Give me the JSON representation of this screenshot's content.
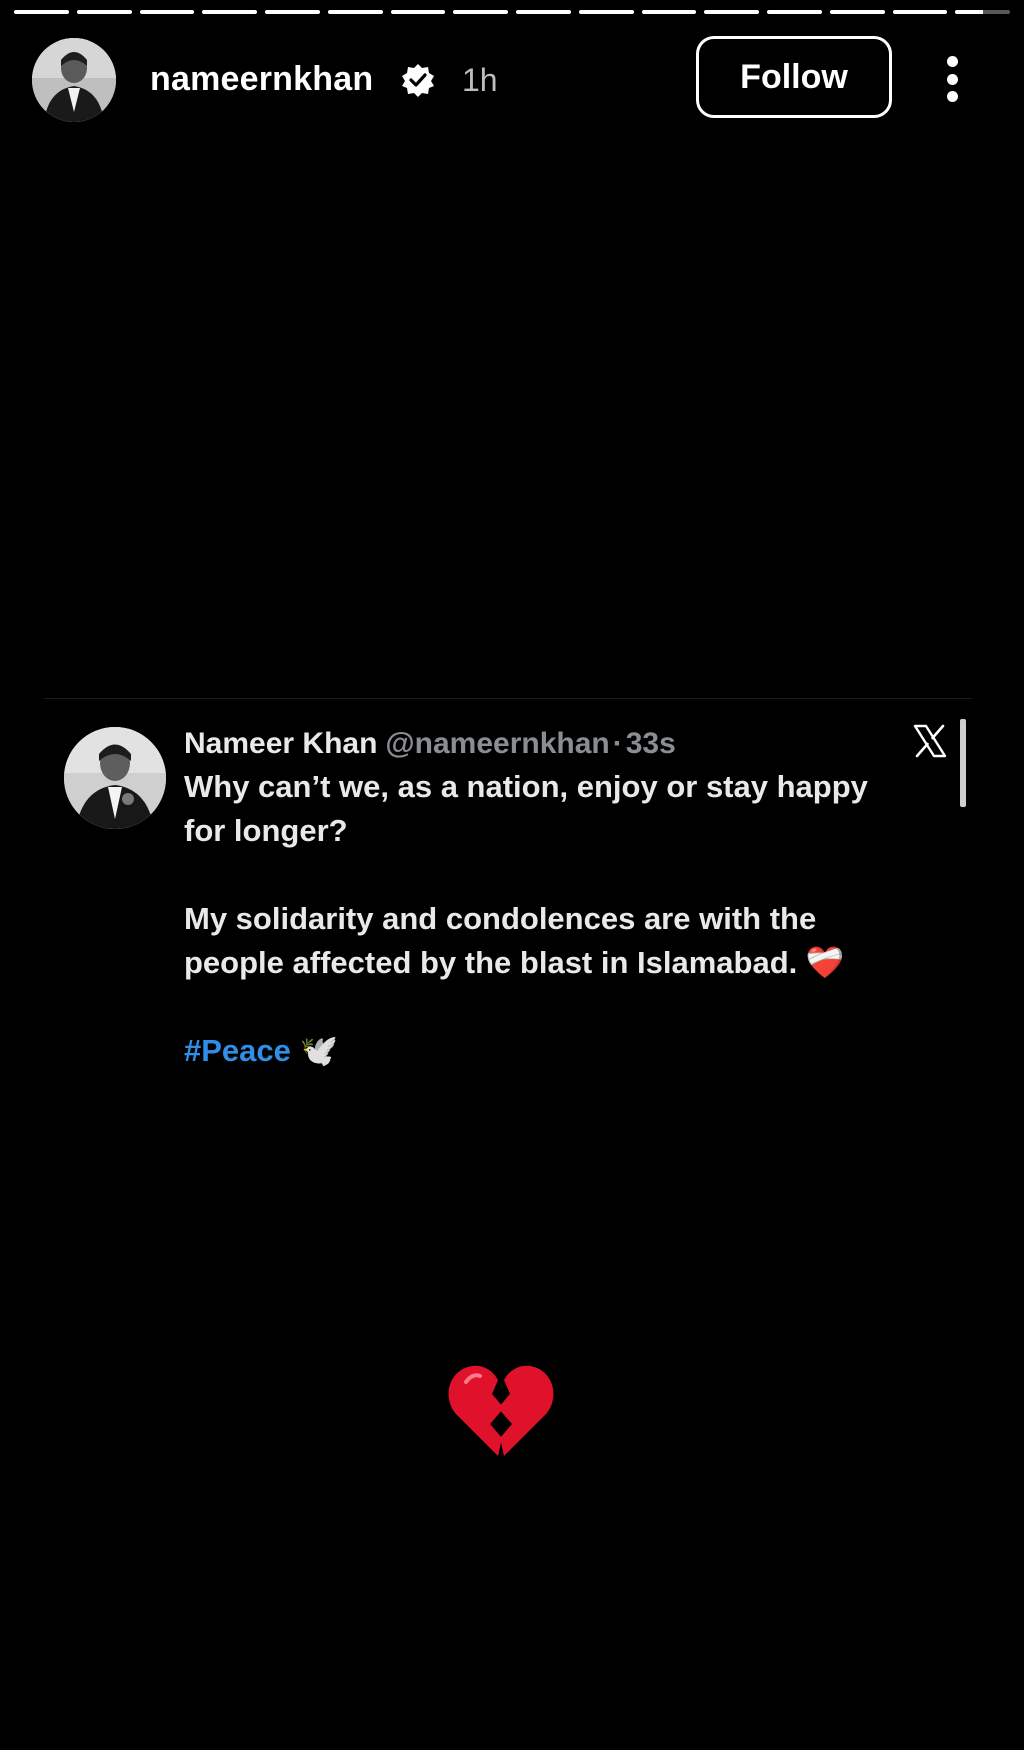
{
  "story": {
    "segments": [
      {
        "progress": 1
      },
      {
        "progress": 1
      },
      {
        "progress": 1
      },
      {
        "progress": 1
      },
      {
        "progress": 1
      },
      {
        "progress": 1
      },
      {
        "progress": 1
      },
      {
        "progress": 1
      },
      {
        "progress": 1
      },
      {
        "progress": 1
      },
      {
        "progress": 1
      },
      {
        "progress": 1
      },
      {
        "progress": 1
      },
      {
        "progress": 1
      },
      {
        "progress": 1
      },
      {
        "progress": 0.5
      }
    ]
  },
  "header": {
    "username": "nameernkhan",
    "verified": true,
    "time": "1h",
    "follow_label": "Follow",
    "more_icon": "more-vertical-icon",
    "avatar_icon": "profile-photo"
  },
  "tweet": {
    "name": "Nameer Khan",
    "handle": "@nameernkhan",
    "separator": "·",
    "age": "33s",
    "platform_icon": "x-logo-icon",
    "line1": "Why can’t we, as a nation, enjoy or stay happy",
    "line2": "for longer?",
    "line3": "My solidarity and condolences are with the",
    "line4": "people affected by the blast in Islamabad.",
    "line4_emoji": "❤️‍🩹",
    "hashtag": "#Peace",
    "hashtag_emoji": "🕊️",
    "hashtag_color": "#2f8fe6"
  },
  "sticker": {
    "icon": "broken-heart-icon",
    "color": "#e0112b"
  }
}
